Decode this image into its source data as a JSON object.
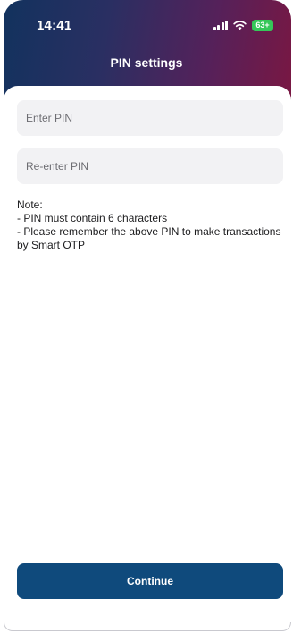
{
  "status_bar": {
    "time": "14:41",
    "battery": "63+",
    "icons": [
      "signal-icon",
      "wifi-icon",
      "battery-icon"
    ]
  },
  "header": {
    "title": "PIN settings"
  },
  "form": {
    "pin_placeholder": "Enter PIN",
    "repin_placeholder": "Re-enter PIN",
    "pin_value": "",
    "repin_value": ""
  },
  "note": {
    "heading": "Note:",
    "line1": "- PIN must contain 6 characters",
    "line2": "- Please remember the above PIN to make transactions by Smart OTP"
  },
  "actions": {
    "continue_label": "Continue"
  },
  "colors": {
    "header_gradient_start": "#12325e",
    "header_gradient_end": "#7a1742",
    "primary_button": "#0f4a7c",
    "input_background": "#f2f2f4",
    "battery_green": "#35c759"
  }
}
